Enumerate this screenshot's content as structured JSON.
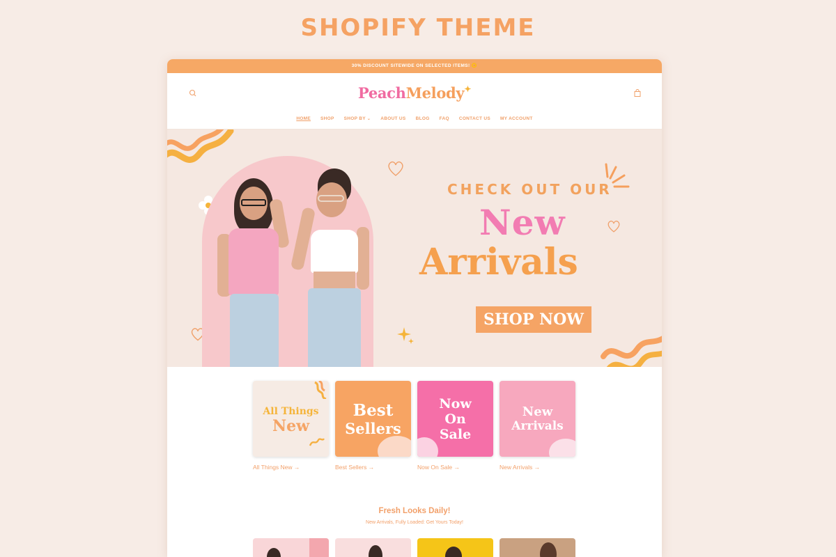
{
  "page_heading": "SHOPIFY THEME",
  "announcement": "30% DISCOUNT SITEWIDE ON SELECTED ITEMS! 🌼",
  "brand": {
    "logo_part1": "Peach",
    "logo_part2": "Melody",
    "logo_sparkle": "✦"
  },
  "nav": {
    "items": [
      "HOME",
      "SHOP",
      "SHOP BY",
      "ABOUT US",
      "BLOG",
      "FAQ",
      "CONTACT US",
      "MY ACCOUNT"
    ],
    "dropdown_caret": "⌄"
  },
  "hero": {
    "pre_title": "CHECK OUT OUR",
    "title_line1": "New",
    "title_line2": "Arrivals",
    "cta": "SHOP NOW"
  },
  "collections": [
    {
      "card_line1": "All Things",
      "card_line2": "New",
      "link": "All Things New →"
    },
    {
      "card_line1": "Best",
      "card_line2": "Sellers",
      "link": "Best Sellers →"
    },
    {
      "card_line1": "Now",
      "card_line2": "On",
      "card_line3": "Sale",
      "link": "Now On Sale →"
    },
    {
      "card_line1": "New",
      "card_line2": "Arrivals",
      "link": "New Arrivals →"
    }
  ],
  "fresh": {
    "title": "Fresh Looks Daily!",
    "subtitle": "New Arrivals, Fully Loaded: Get Yours Today!"
  },
  "colors": {
    "accent_orange": "#f5a465",
    "accent_pink": "#f27cb2",
    "background": "#f7ece6",
    "announcement_bar": "#f6a865"
  },
  "icons": {
    "search": "search-icon",
    "cart": "cart-icon"
  }
}
